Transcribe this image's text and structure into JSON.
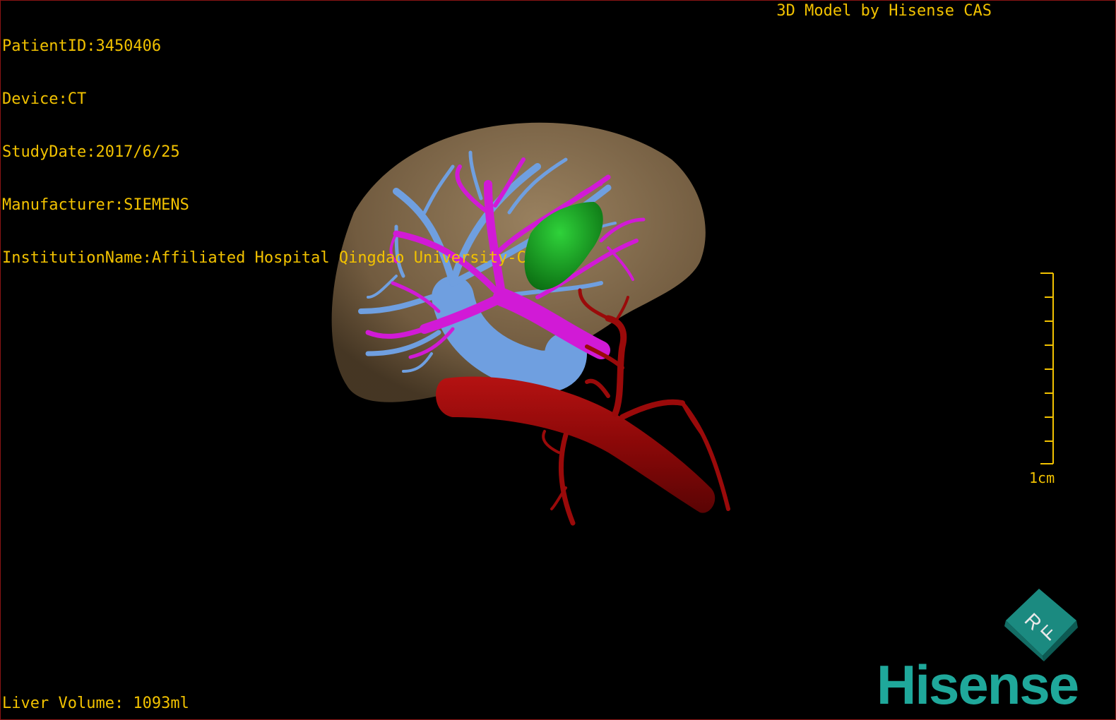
{
  "info": {
    "patient_id": "PatientID:3450406",
    "device": "Device:CT",
    "study_date": "StudyDate:2017/6/25",
    "manufacturer": "Manufacturer:SIEMENS",
    "institution": "InstitutionName:Affiliated Hospital Qingdao University-C"
  },
  "credit": "3D Model by Hisense CAS",
  "volume": "Liver Volume: 1093ml",
  "scale_label": "1cm",
  "cube": {
    "top_letter": "R",
    "front_letter": "F"
  },
  "logo": "Hisense",
  "colors": {
    "overlay_text": "#f2c200",
    "liver": "#8b7150",
    "portal_vein": "#d11ad6",
    "hepatic_vein": "#6f9fe0",
    "tumor": "#12a81c",
    "artery_aorta": "#9a0a0a",
    "brand": "#1fa89b"
  }
}
